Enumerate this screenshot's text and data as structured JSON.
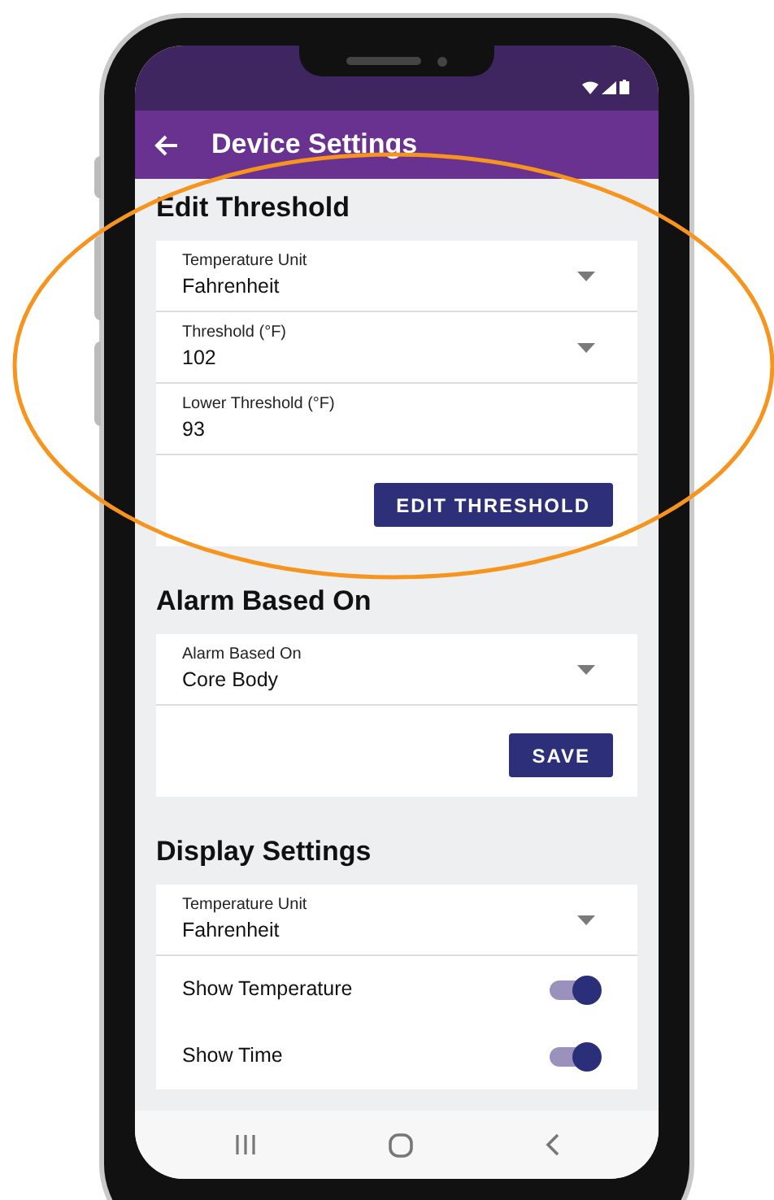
{
  "app_bar": {
    "title": "Device Settings"
  },
  "sections": [
    {
      "title": "Edit Threshold",
      "fields": [
        {
          "kind": "dropdown",
          "label": "Temperature Unit",
          "value": "Fahrenheit"
        },
        {
          "kind": "dropdown",
          "label": "Threshold (°F)",
          "value": "102"
        },
        {
          "kind": "text",
          "label": "Lower Threshold (°F)",
          "value": "93"
        }
      ],
      "button": "EDIT THRESHOLD"
    },
    {
      "title": "Alarm Based On",
      "fields": [
        {
          "kind": "dropdown",
          "label": "Alarm Based On",
          "value": "Core Body"
        }
      ],
      "button": "SAVE"
    },
    {
      "title": "Display Settings",
      "fields": [
        {
          "kind": "dropdown",
          "label": "Temperature Unit",
          "value": "Fahrenheit"
        },
        {
          "kind": "toggle",
          "label": "Show Temperature",
          "on": true
        },
        {
          "kind": "toggle",
          "label": "Show Time",
          "on": true
        }
      ]
    }
  ]
}
